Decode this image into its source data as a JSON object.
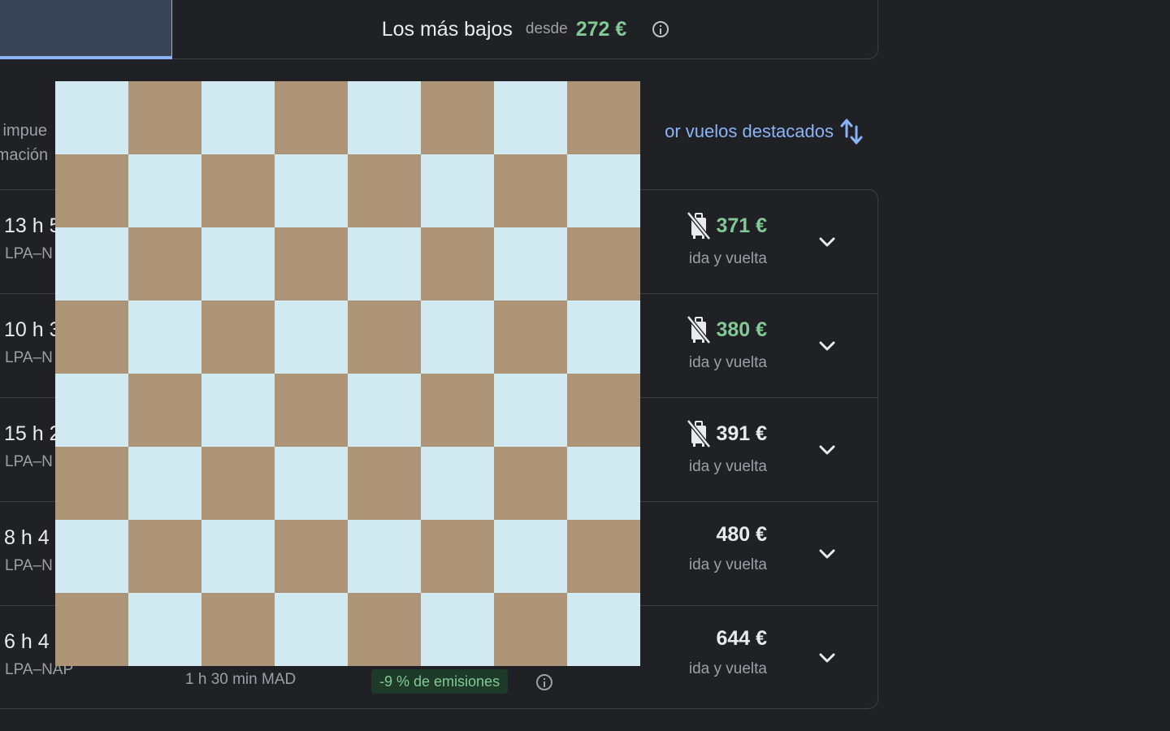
{
  "sort_tabs": {
    "cheapest_label": "Los más bajos",
    "from_label": "desde",
    "cheapest_price": "272 €"
  },
  "note": {
    "line1": "s impue",
    "line2": "rmación"
  },
  "sort_link": {
    "label": "or vuelos destacados"
  },
  "results": [
    {
      "duration": "13 h 5",
      "route": "LPA–N",
      "stops": "",
      "emissions": "",
      "price": "371 €",
      "price_color": "green",
      "no_bag": true,
      "price_sub": "ida y vuelta"
    },
    {
      "duration": "10 h 3",
      "route": "LPA–N",
      "stops": "",
      "emissions": "",
      "price": "380 €",
      "price_color": "green",
      "no_bag": true,
      "price_sub": "ida y vuelta"
    },
    {
      "duration": "15 h 2",
      "route": "LPA–N",
      "stops": "",
      "emissions": "",
      "price": "391 €",
      "price_color": "white",
      "no_bag": true,
      "price_sub": "ida y vuelta"
    },
    {
      "duration": "8 h 4",
      "route": "LPA–N",
      "stops": "",
      "emissions": "",
      "price": "480 €",
      "price_color": "white",
      "no_bag": false,
      "price_sub": "ida y vuelta"
    },
    {
      "duration": "6 h 4",
      "route": "LPA–NAP",
      "stops": "1 h 30 min MAD",
      "emissions": "-9 % de emisiones",
      "price": "644 €",
      "price_color": "white",
      "no_bag": false,
      "price_sub": "ida y vuelta"
    }
  ],
  "colors": {
    "background": "#202124",
    "accent": "#8ab4f8",
    "price_green": "#81c995",
    "board_light": "#d2ebf3",
    "board_dark": "#af9577"
  },
  "overlay": {
    "type": "checkerboard",
    "rows": 8,
    "cols": 8
  }
}
